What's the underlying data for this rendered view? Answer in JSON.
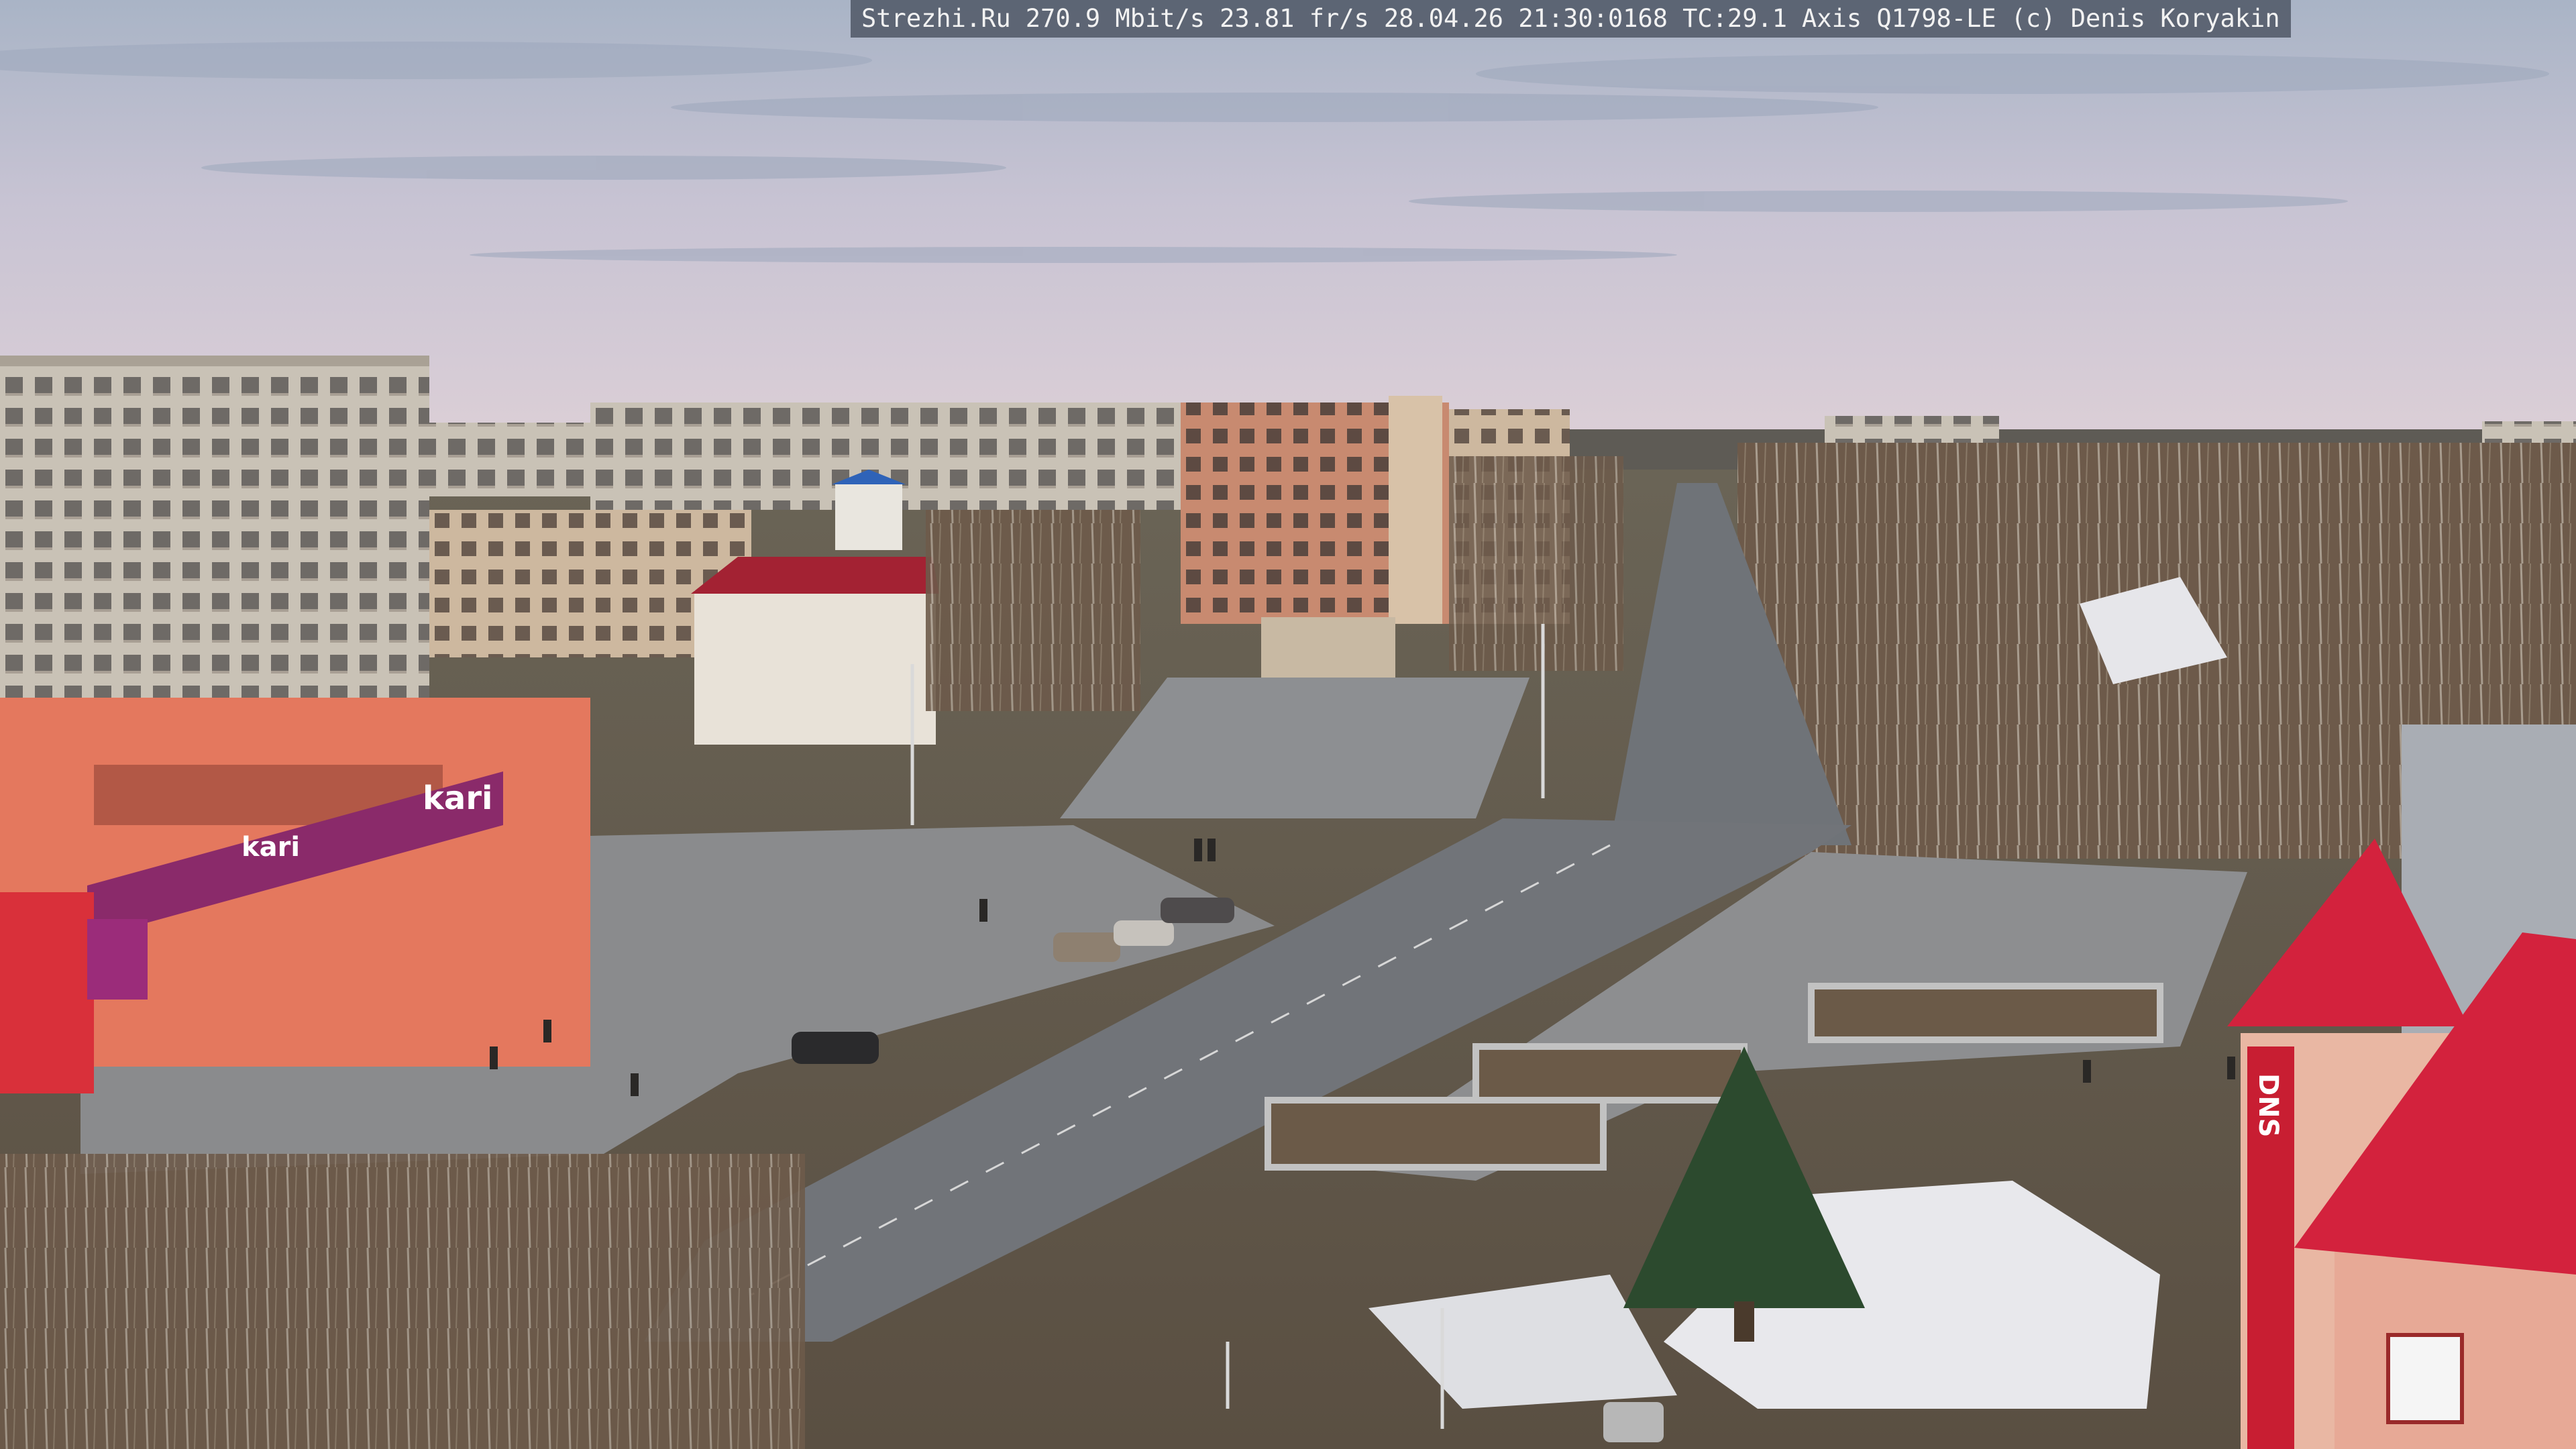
{
  "overlay": {
    "site": "Strezhi.Ru",
    "bitrate": "270.9 Mbit/s",
    "framerate": "23.81 fr/s",
    "datetime": "28.04.26 21:30:0168",
    "tc": "TC:29.1",
    "camera": "Axis Q1798-LE",
    "copyright": "(c) Denis Koryakin"
  },
  "signs": {
    "store_brand": "kari",
    "store_brand_lower": "kari",
    "dns_vertical": "DNS"
  },
  "colors": {
    "sky_top": "#b7bfcf",
    "sky_bottom": "#d9cdd8",
    "road": "#6f7277",
    "plaza": "#8d8f93",
    "store_facade": "#e4785e",
    "kari_banner": "#8a2a6a",
    "roof_red": "#d3223d"
  }
}
